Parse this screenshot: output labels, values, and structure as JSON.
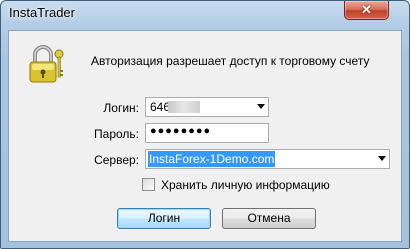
{
  "window": {
    "title": "InstaTrader"
  },
  "info_text": "Авторизация разрешает доступ к торговому счету",
  "login": {
    "label": "Логин:",
    "value": "646"
  },
  "password": {
    "label": "Пароль:",
    "masked_value": "●●●●●●●●"
  },
  "server": {
    "label": "Сервер:",
    "selected": "InstaForex-1Demo.com"
  },
  "save_info": {
    "label": "Хранить личную информацию",
    "checked": false
  },
  "buttons": {
    "ok": "Логин",
    "cancel": "Отмена"
  },
  "icons": {
    "close": "close-icon",
    "lock": "lock-keys-icon"
  },
  "colors": {
    "accent_selection": "#3399ff",
    "close_button": "#c7503a"
  }
}
